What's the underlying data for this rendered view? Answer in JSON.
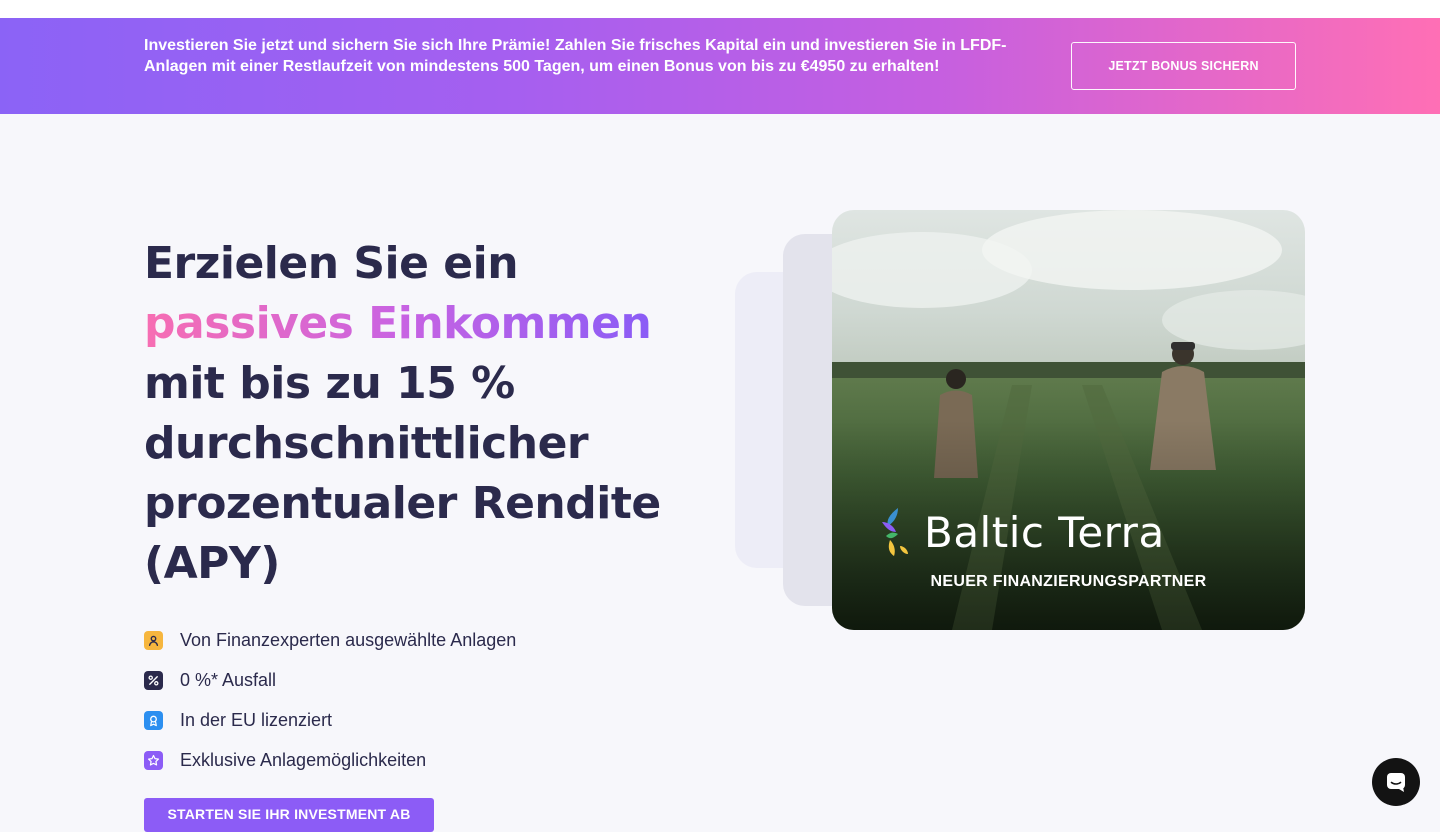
{
  "promo": {
    "text": "Investieren Sie jetzt und sichern Sie sich Ihre Prämie! Zahlen Sie frisches Kapital ein und investieren Sie in LFDF-Anlagen mit einer Restlaufzeit von mindestens 500 Tagen, um einen Bonus von bis zu €4950 zu erhalten!",
    "button_label": "JETZT BONUS SICHERN"
  },
  "hero": {
    "title_part1": "Erzielen Sie ein ",
    "title_highlight": "passives Einkommen",
    "title_part2": " mit bis zu 15 % durchschnittlicher prozentualer Rendite (APY)",
    "features": [
      {
        "icon": "user-icon",
        "color": "#f6b63e",
        "label": "Von Finanzexperten ausgewählte Anlagen"
      },
      {
        "icon": "percent-icon",
        "color": "#2b2a4c",
        "label": "0 %* Ausfall"
      },
      {
        "icon": "badge-icon",
        "color": "#2c8ff0",
        "label": "In der EU lizenziert"
      },
      {
        "icon": "star-icon",
        "color": "#8c5cf6",
        "label": "Exklusive Anlagemöglichkeiten"
      }
    ],
    "cta_label": "STARTEN SIE IHR INVESTMENT AB"
  },
  "partner": {
    "name": "Baltic Terra",
    "subtitle": "NEUER FINANZIERUNGSPARTNER"
  },
  "chat": {
    "icon": "chat-icon"
  }
}
